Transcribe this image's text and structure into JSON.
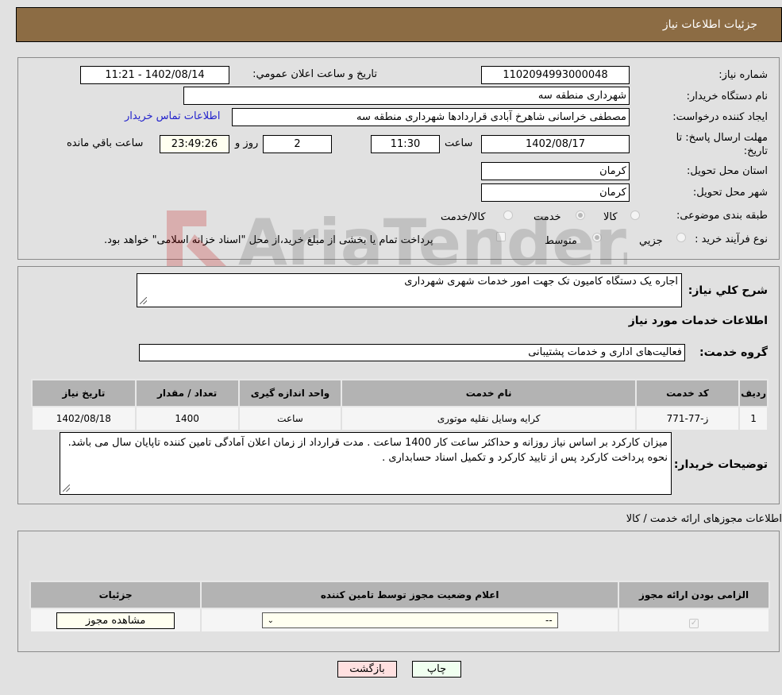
{
  "header": {
    "title": "جزئیات اطلاعات نیاز"
  },
  "form": {
    "need_number_label": "شماره نیاز:",
    "need_number": "1102094993000048",
    "announce_label": "تاریخ و ساعت اعلان عمومي:",
    "announce_value": "1402/08/14 - 11:21",
    "buyer_org_label": "نام دستگاه خریدار:",
    "buyer_org": "شهرداری منطقه سه",
    "creator_label": "ایجاد کننده درخواست:",
    "creator": "مصطفی خراسانی شاهرخ آبادی قراردادها شهرداری منطقه سه",
    "contact_link": "اطلاعات تماس خریدار",
    "deadline_label_line1": "مهلت ارسال پاسخ: تا",
    "deadline_label_line2": "تاریخ:",
    "deadline_date": "1402/08/17",
    "time_label": "ساعت",
    "deadline_time": "11:30",
    "days": "2",
    "days_label": "روز و",
    "remaining_time": "23:49:26",
    "remaining_label": "ساعت باقي مانده",
    "province_label": "استان محل تحویل:",
    "province": "کرمان",
    "city_label": "شهر محل تحویل:",
    "city": "کرمان",
    "category_label": "طبقه بندی موضوعی:",
    "category_options": [
      {
        "label": "کالا",
        "checked": false
      },
      {
        "label": "خدمت",
        "checked": true
      },
      {
        "label": "کالا/خدمت",
        "checked": false
      }
    ],
    "process_label": "نوع فرآیند خرید :",
    "process_options": [
      {
        "label": "جزيي",
        "checked": false
      },
      {
        "label": "متوسط",
        "checked": true
      }
    ],
    "treasury_note": "پرداخت تمام یا بخشی از مبلغ خرید،از محل \"اسناد خزانه اسلامی\" خواهد بود."
  },
  "description": {
    "label": "شرح کلي نياز:",
    "value": "اجاره یک دستگاه کامیون تک جهت امور خدمات شهری شهرداری"
  },
  "services": {
    "section_title": "اطلاعات خدمات مورد نیاز",
    "group_label": "گروه خدمت:",
    "group_value": "فعالیت‌های اداری و خدمات پشتیبانی",
    "table": {
      "headers": [
        "ردیف",
        "کد خدمت",
        "نام خدمت",
        "واحد اندازه گیری",
        "تعداد / مقدار",
        "تاریخ نیاز"
      ],
      "rows": [
        [
          "1",
          "ز-77-771",
          "کرایه وسایل نقلیه موتوری",
          "ساعت",
          "1400",
          "1402/08/18"
        ]
      ]
    },
    "buyer_notes_label": "توضیحات خریدار:",
    "buyer_notes": "میزان کارکرد بر اساس نیاز روزانه و حداکثر ساعت کار 1400 ساعت .   مدت قرارداد از زمان اعلان آمادگی تامین کننده  تاپایان سال می باشد. نحوه پرداخت کارکرد پس از تایید کارکرد و تکمیل اسناد حسابداری ."
  },
  "permits": {
    "section_title": "اطلاعات مجوزهای ارائه خدمت / کالا",
    "headers": [
      "الزامی بودن ارائه مجوز",
      "اعلام وضعیت مجوز توسط تامین کننده",
      "جزئیات"
    ],
    "row": {
      "required": true,
      "status_selected": "--",
      "details_button": "مشاهده مجوز"
    }
  },
  "actions": {
    "print": "چاپ",
    "back": "بازگشت"
  },
  "watermark": {
    "text": "AriaTender.neT"
  }
}
